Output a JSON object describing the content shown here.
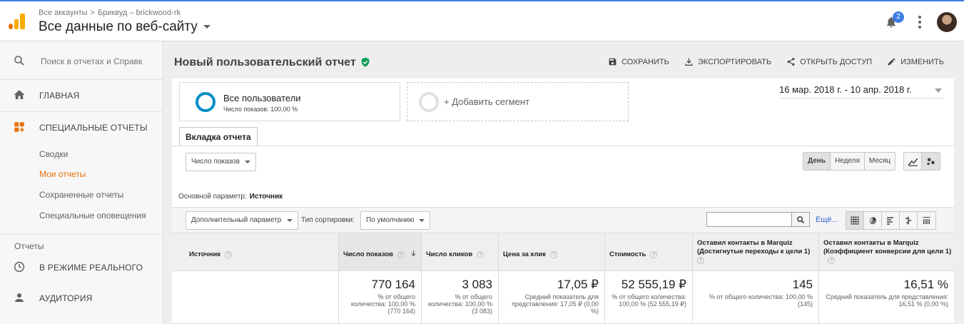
{
  "header": {
    "breadcrumb_root": "Все аккаунты",
    "breadcrumb_sep": ">",
    "breadcrumb_account": "Бриквуд – brickwood-rk",
    "view_title": "Все данные по веб-сайту",
    "notifications_count": "2"
  },
  "sidebar": {
    "search_placeholder": "Поиск в отчетах и Справк",
    "home": "ГЛАВНАЯ",
    "custom_reports": "СПЕЦИАЛЬНЫЕ ОТЧЕТЫ",
    "sub_items": [
      "Сводки",
      "Мои отчеты",
      "Сохраненные отчеты",
      "Специальные оповещения"
    ],
    "reports_section": "Отчеты",
    "realtime": "В РЕЖИМЕ РЕАЛЬНОГО",
    "audience": "АУДИТОРИЯ"
  },
  "report": {
    "title": "Новый пользовательский отчет",
    "actions": [
      "СОХРАНИТЬ",
      "ЭКСПОРТИРОВАТЬ",
      "ОТКРЫТЬ ДОСТУП",
      "ИЗМЕНИТЬ"
    ],
    "segment_name": "Все пользователи",
    "segment_sub": "Число показов: 100,00 %",
    "add_segment": "+ Добавить сегмент",
    "date_range": "16 мар. 2018 г. - 10 апр. 2018 г.",
    "tab_label": "Вкладка отчета",
    "metric_select": "Число показов",
    "period_buttons": [
      "День",
      "Неделя",
      "Месяц"
    ],
    "primary_dim_label": "Основной параметр:",
    "primary_dim_value": "Источник",
    "secondary_dim": "Дополнительный параметр",
    "sort_label": "Тип сортировки:",
    "sort_value": "По умолчанию",
    "search_value": "",
    "more_link": "Ещё..."
  },
  "table": {
    "headers": [
      "Источник",
      "Число показов",
      "Число кликов",
      "Цена за клик",
      "Стоимость",
      "Оставил контакты в Marquiz (Достигнутые переходы к цели 1)",
      "Оставил контакты в Marquiz (Коэффициент конверсии для цели 1)"
    ],
    "totals": [
      {
        "value": "770 164",
        "sub": "% от общего количества: 100,00 % (770 164)"
      },
      {
        "value": "3 083",
        "sub": "% от общего количества: 100,00 % (3 083)"
      },
      {
        "value": "17,05 ₽",
        "sub": "Средний показатель для представления: 17,05 ₽ (0,00 %)"
      },
      {
        "value": "52 555,19 ₽",
        "sub": "% от общего количества: 100,00 % (52 555,19 ₽)"
      },
      {
        "value": "145",
        "sub": "% от общего количества: 100,00 % (145)"
      },
      {
        "value": "16,51 %",
        "sub": "Средний показатель для представления: 16,51 % (0,00 %)"
      }
    ]
  },
  "colors": {
    "accent": "#e8710a",
    "segment_ring": "#058dc7",
    "link": "#3367d6",
    "verified": "#0f9d58"
  }
}
